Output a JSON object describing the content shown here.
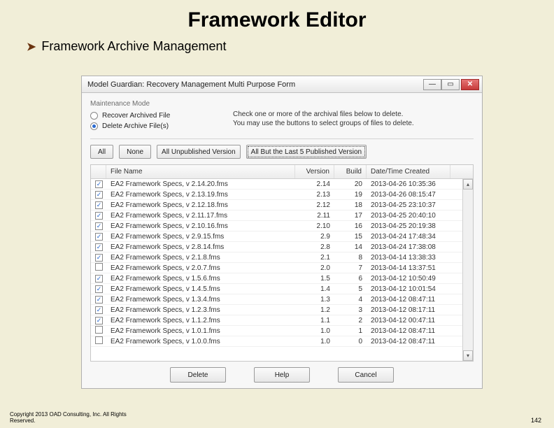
{
  "slide": {
    "title": "Framework Editor",
    "bullet": "Framework Archive Management",
    "copyright": "Copyright 2013 OAD Consulting, Inc. All Rights",
    "copyright2": "Reserved.",
    "page_number": "142"
  },
  "window": {
    "title": "Model Guardian: Recovery Management Multi Purpose Form",
    "mode_label": "Maintenance Mode",
    "radio_recover": "Recover Archived File",
    "radio_delete": "Delete Archive File(s)",
    "selected_mode": "delete",
    "instructions_l1": "Check one or more of the archival files below to delete.",
    "instructions_l2": "You may use the buttons to select groups of files to delete.",
    "sel_all": "All",
    "sel_none": "None",
    "sel_unpub": "All Unpublished Version",
    "sel_last5": "All But the Last 5 Published Version",
    "col_file": "File Name",
    "col_ver": "Version",
    "col_build": "Build",
    "col_date": "Date/Time Created",
    "btn_delete": "Delete",
    "btn_help": "Help",
    "btn_cancel": "Cancel"
  },
  "rows": [
    {
      "c": true,
      "name": "EA2 Framework Specs, v 2.14.20.fms",
      "ver": "2.14",
      "build": "20",
      "date": "2013-04-26 10:35:36"
    },
    {
      "c": true,
      "name": "EA2 Framework Specs, v 2.13.19.fms",
      "ver": "2.13",
      "build": "19",
      "date": "2013-04-26 08:15:47"
    },
    {
      "c": true,
      "name": "EA2 Framework Specs, v 2.12.18.fms",
      "ver": "2.12",
      "build": "18",
      "date": "2013-04-25 23:10:37"
    },
    {
      "c": true,
      "name": "EA2 Framework Specs, v 2.11.17.fms",
      "ver": "2.11",
      "build": "17",
      "date": "2013-04-25 20:40:10"
    },
    {
      "c": true,
      "name": "EA2 Framework Specs, v 2.10.16.fms",
      "ver": "2.10",
      "build": "16",
      "date": "2013-04-25 20:19:38"
    },
    {
      "c": true,
      "name": "EA2 Framework Specs, v 2.9.15.fms",
      "ver": "2.9",
      "build": "15",
      "date": "2013-04-24 17:48:34"
    },
    {
      "c": true,
      "name": "EA2 Framework Specs, v 2.8.14.fms",
      "ver": "2.8",
      "build": "14",
      "date": "2013-04-24 17:38:08"
    },
    {
      "c": true,
      "name": "EA2 Framework Specs, v 2.1.8.fms",
      "ver": "2.1",
      "build": "8",
      "date": "2013-04-14 13:38:33"
    },
    {
      "c": false,
      "name": "EA2 Framework Specs, v 2.0.7.fms",
      "ver": "2.0",
      "build": "7",
      "date": "2013-04-14 13:37:51"
    },
    {
      "c": true,
      "name": "EA2 Framework Specs, v 1.5.6.fms",
      "ver": "1.5",
      "build": "6",
      "date": "2013-04-12 10:50:49"
    },
    {
      "c": true,
      "name": "EA2 Framework Specs, v 1.4.5.fms",
      "ver": "1.4",
      "build": "5",
      "date": "2013-04-12 10:01:54"
    },
    {
      "c": true,
      "name": "EA2 Framework Specs, v 1.3.4.fms",
      "ver": "1.3",
      "build": "4",
      "date": "2013-04-12 08:47:11"
    },
    {
      "c": true,
      "name": "EA2 Framework Specs, v 1.2.3.fms",
      "ver": "1.2",
      "build": "3",
      "date": "2013-04-12 08:17:11"
    },
    {
      "c": true,
      "name": "EA2 Framework Specs, v 1.1.2.fms",
      "ver": "1.1",
      "build": "2",
      "date": "2013-04-12 00:47:11"
    },
    {
      "c": false,
      "name": "EA2 Framework Specs, v 1.0.1.fms",
      "ver": "1.0",
      "build": "1",
      "date": "2013-04-12 08:47:11"
    },
    {
      "c": false,
      "name": "EA2 Framework Specs, v 1.0.0.fms",
      "ver": "1.0",
      "build": "0",
      "date": "2013-04-12 08:47:11"
    }
  ]
}
